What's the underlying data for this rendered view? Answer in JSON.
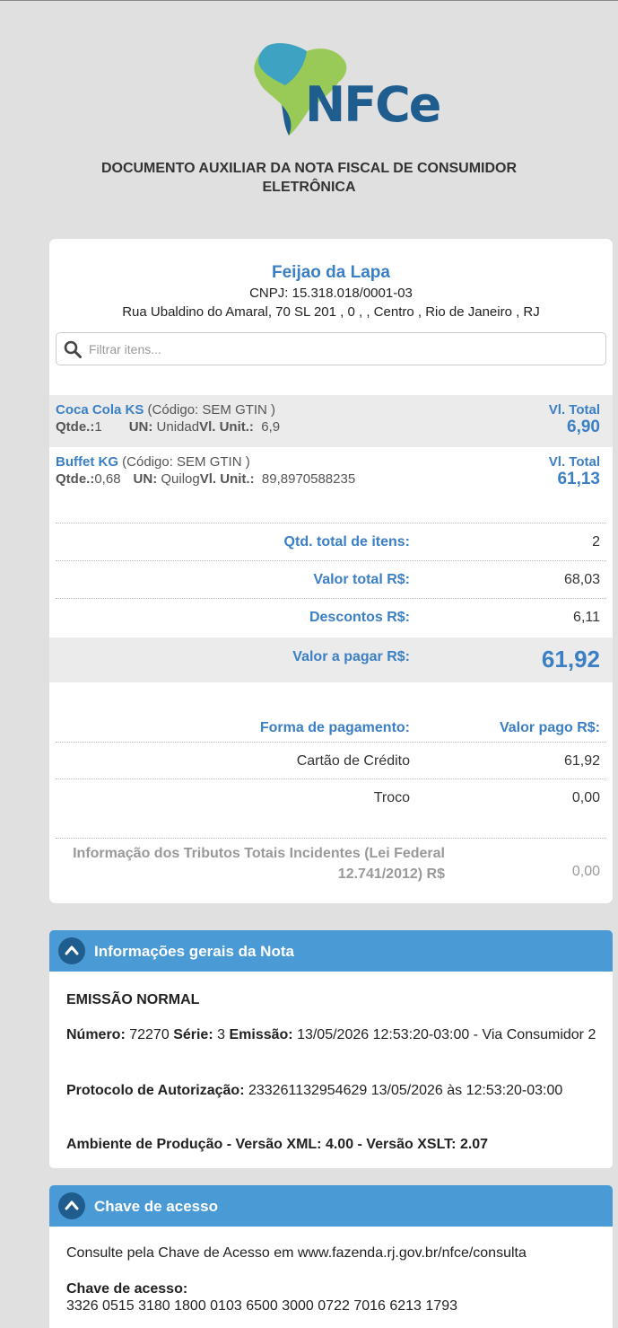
{
  "header": {
    "logo_text": "NFCe",
    "doc_title": "DOCUMENTO AUXILIAR DA NOTA FISCAL DE CONSUMIDOR ELETRÔNICA"
  },
  "store": {
    "name": "Feijao da Lapa",
    "cnpj": "CNPJ: 15.318.018/0001-03",
    "address": "Rua Ubaldino do Amaral, 70 SL 201 , 0 , , Centro , Rio de Janeiro , RJ"
  },
  "search": {
    "placeholder": "Filtrar itens..."
  },
  "items": [
    {
      "name": "Coca Cola KS",
      "code": " (Código: SEM GTIN )",
      "qty_label": "Qtde.:",
      "qty": "1",
      "un_label": "UN: ",
      "un": "Unidad",
      "unit_label": "Vl. Unit.:",
      "unit": "6,9",
      "total_label": "Vl. Total",
      "total": "6,90"
    },
    {
      "name": "Buffet KG",
      "code": " (Código: SEM GTIN )",
      "qty_label": "Qtde.:",
      "qty": "0,68",
      "un_label": "UN: ",
      "un": "Quilog",
      "unit_label": "Vl. Unit.:",
      "unit": "89,8970588235",
      "total_label": "Vl. Total",
      "total": "61,13"
    }
  ],
  "totals": {
    "qtd_label": "Qtd. total de itens:",
    "qtd_value": "2",
    "valor_total_label": "Valor total R$:",
    "valor_total_value": "68,03",
    "descontos_label": "Descontos R$:",
    "descontos_value": "6,11",
    "a_pagar_label": "Valor a pagar R$:",
    "a_pagar_value": "61,92"
  },
  "payment": {
    "header_label": "Forma de pagamento:",
    "header_value": "Valor pago R$:",
    "method": "Cartão de Crédito",
    "method_value": "61,92",
    "troco_label": "Troco",
    "troco_value": "0,00"
  },
  "tributos": {
    "label": "Informação dos Tributos Totais Incidentes (Lei Federal 12.741/2012) R$",
    "value": "0,00"
  },
  "info_panel": {
    "title": "Informações gerais da Nota",
    "emissao_tipo": "EMISSÃO NORMAL",
    "numero_label": "Número:",
    "numero": "72270",
    "serie_label": "Série:",
    "serie": "3",
    "emissao_label": "Emissão:",
    "emissao": "13/05/2026 12:53:20-03:00 - Via Consumidor 2",
    "protocolo_label": "Protocolo de Autorização:",
    "protocolo": "233261132954629 13/05/2026 às 12:53:20-03:00",
    "ambiente": "Ambiente de Produção - Versão XML: 4.00 - Versão XSLT: 2.07"
  },
  "chave_panel": {
    "title": "Chave de acesso",
    "consulta": "Consulte pela Chave de Acesso em www.fazenda.rj.gov.br/nfce/consulta",
    "chave_label": "Chave de acesso:",
    "chave": "3326 0515 3180 1800 0103 6500 3000 0722 7016 6213 1793"
  },
  "colors": {
    "accent": "#3b7fc4",
    "panel_header": "#4a9ad6",
    "background": "#e0e0e0"
  }
}
